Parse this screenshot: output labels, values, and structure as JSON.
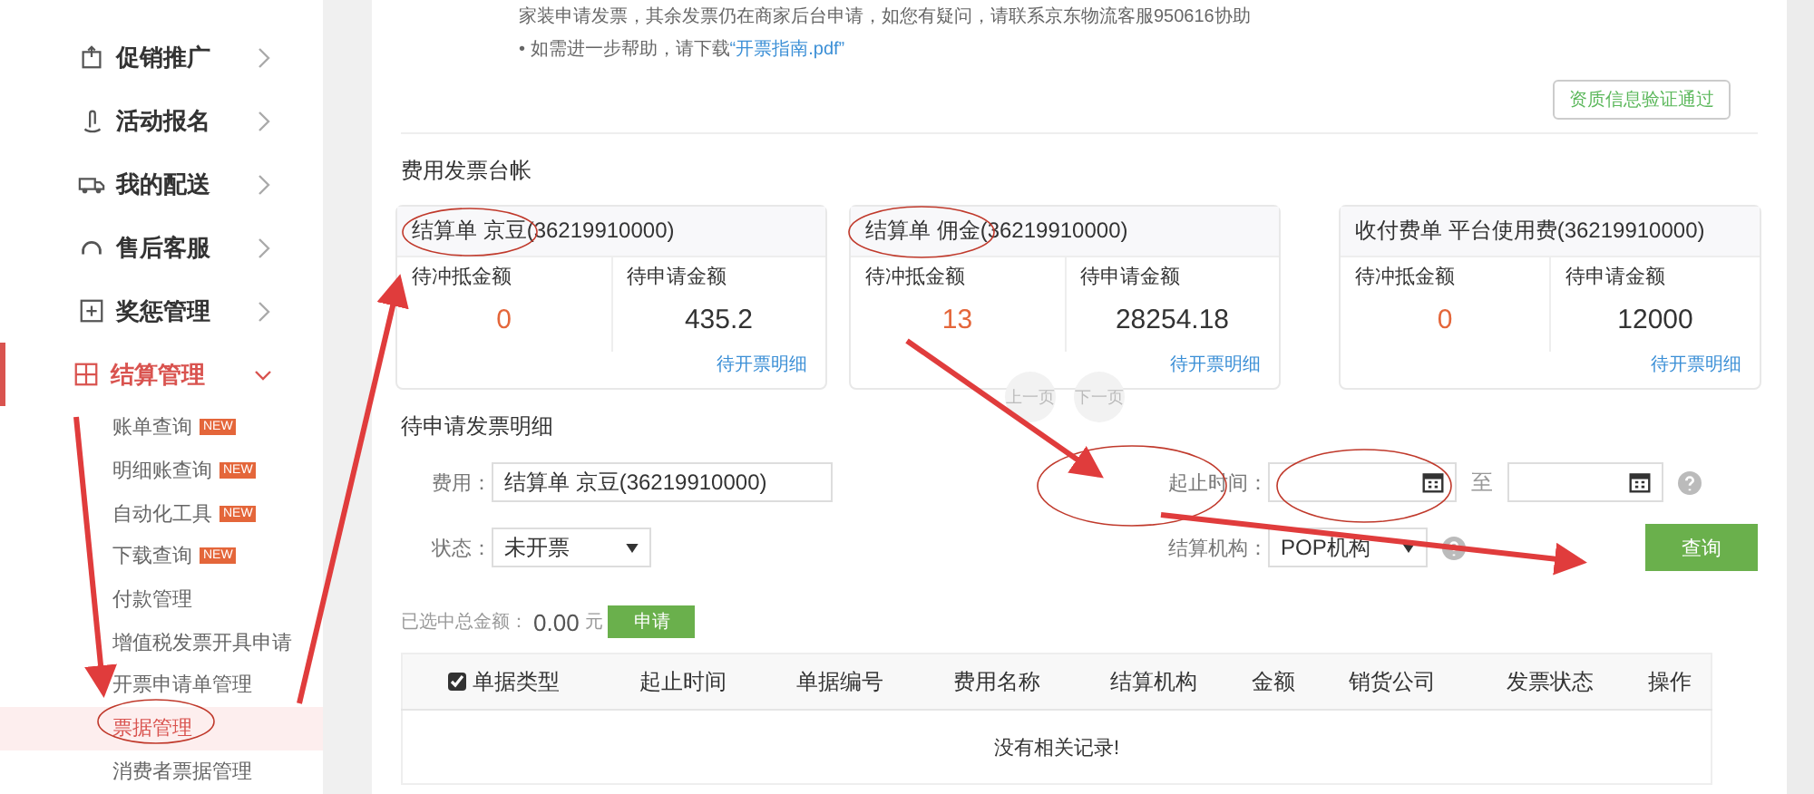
{
  "sidebar": {
    "items": [
      {
        "label": "促销推广",
        "kind": "bag",
        "expanded": false,
        "selected": false
      },
      {
        "label": "活动报名",
        "kind": "hand",
        "expanded": false,
        "selected": false
      },
      {
        "label": "我的配送",
        "kind": "truck",
        "expanded": false,
        "selected": false
      },
      {
        "label": "售后客服",
        "kind": "headset",
        "expanded": false,
        "selected": false
      },
      {
        "label": "奖惩管理",
        "kind": "plus",
        "expanded": false,
        "selected": false
      },
      {
        "label": "结算管理",
        "kind": "grid",
        "expanded": true,
        "selected": true,
        "children": [
          {
            "label": "账单查询",
            "badge": "NEW",
            "selected": false
          },
          {
            "label": "明细账查询",
            "badge": "NEW",
            "selected": false
          },
          {
            "label": "自动化工具",
            "badge": "NEW",
            "selected": false
          },
          {
            "label": "下载查询",
            "badge": "NEW",
            "selected": false
          },
          {
            "label": "付款管理",
            "selected": false
          },
          {
            "label": "增值税发票开具申请",
            "selected": false
          },
          {
            "label": "开票申请单管理",
            "selected": false
          },
          {
            "label": "票据管理",
            "selected": true
          },
          {
            "label": "消费者票据管理",
            "selected": false
          }
        ]
      }
    ]
  },
  "notice": {
    "line": "家装申请发票，其余发票仍在商家后台申请，如您有疑问，请联系京东物流客服950616协助",
    "help": "• 如需进一步帮助，请下载",
    "link": "“开票指南.pdf”",
    "verified": "资质信息验证通过"
  },
  "ledger": {
    "title": "费用发票台帐",
    "cards": [
      {
        "title": "结算单 京豆(36219910000)",
        "left_label": "待冲抵金额",
        "left_value": "0",
        "right_label": "待申请金额",
        "right_value": "435.2",
        "link": "待开票明细"
      },
      {
        "title": "结算单 佣金(36219910000)",
        "left_label": "待冲抵金额",
        "left_value": "13",
        "right_label": "待申请金额",
        "right_value": "28254.18",
        "link": "待开票明细"
      },
      {
        "title": "收付费单 平台使用费(36219910000)",
        "left_label": "待冲抵金额",
        "left_value": "0",
        "right_label": "待申请金额",
        "right_value": "12000",
        "link": "待开票明细"
      }
    ],
    "pager": [
      "上一页",
      "下一页"
    ]
  },
  "details": {
    "title": "待申请发票明细",
    "cost_label": "费用：",
    "cost_value": "结算单 京豆(36219910000)",
    "date_label": "起止时间：",
    "date_sep": "至",
    "status_label": "状态：",
    "status_value": "未开票",
    "org_label": "结算机构：",
    "org_value": "POP机构",
    "query": "查询",
    "total_label": "已选中总金额：",
    "total_value": "0.00",
    "total_unit": "元",
    "apply": "申请"
  },
  "table": {
    "select_all": true,
    "columns": [
      "单据类型",
      "起止时间",
      "单据编号",
      "费用名称",
      "结算机构",
      "金额",
      "销货公司",
      "发票状态",
      "操作"
    ],
    "empty": "没有相关记录!"
  }
}
